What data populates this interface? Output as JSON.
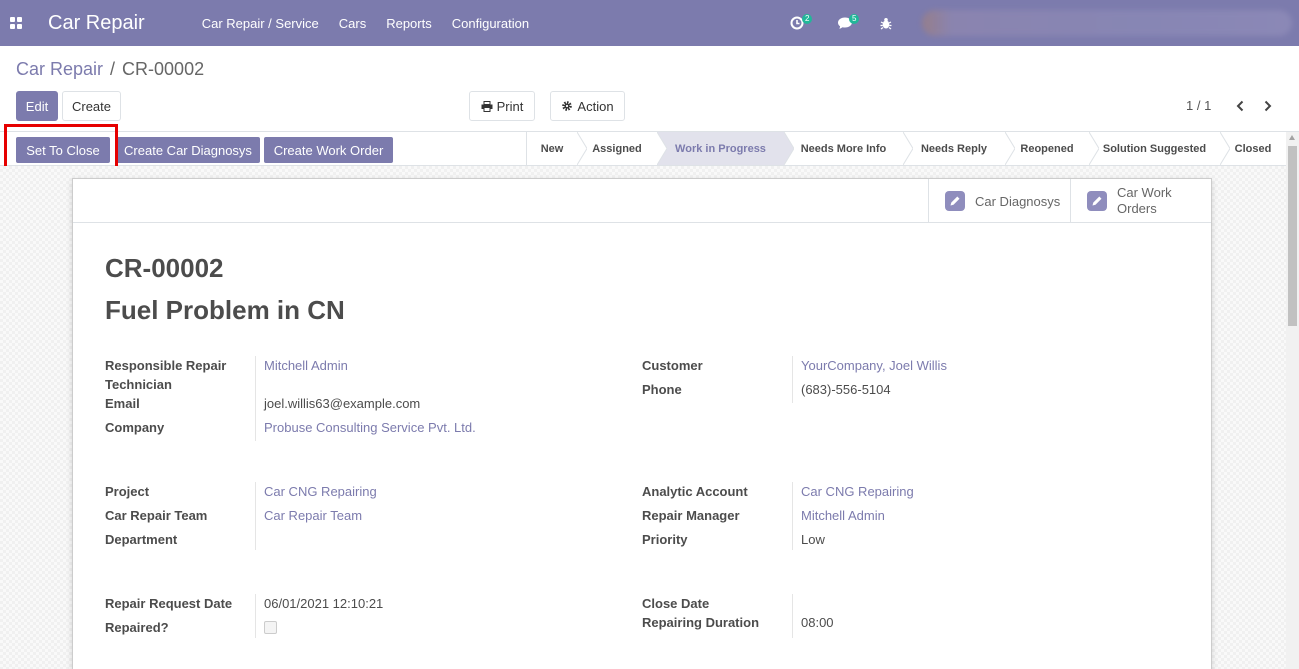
{
  "topbar": {
    "app_title": "Car Repair",
    "menu": [
      "Car Repair / Service",
      "Cars",
      "Reports",
      "Configuration"
    ],
    "activity_count": "2",
    "messages_count": "5"
  },
  "breadcrumb": {
    "parent": "Car Repair",
    "separator": "/",
    "current": "CR-00002"
  },
  "controls": {
    "edit": "Edit",
    "create": "Create",
    "print": "Print",
    "action": "Action",
    "pager": "1 / 1"
  },
  "header_buttons": {
    "set_to_close": "Set To Close",
    "create_diagnosys": "Create Car Diagnosys",
    "create_work_order": "Create Work Order"
  },
  "stages": [
    "New",
    "Assigned",
    "Work in Progress",
    "Needs More Info",
    "Needs Reply",
    "Reopened",
    "Solution Suggested",
    "Closed"
  ],
  "active_stage": "Work in Progress",
  "smart_buttons": {
    "diagnosys": "Car Diagnosys",
    "work_orders_line1": "Car Work",
    "work_orders_line2": "Orders"
  },
  "record": {
    "code": "CR-00002",
    "name": "Fuel Problem in CN"
  },
  "fields": {
    "technician_label": "Responsible Repair Technician",
    "technician": "Mitchell Admin",
    "email_label": "Email",
    "email": "joel.willis63@example.com",
    "company_label": "Company",
    "company": "Probuse Consulting Service Pvt. Ltd.",
    "customer_label": "Customer",
    "customer": "YourCompany, Joel Willis",
    "phone_label": "Phone",
    "phone": "(683)-556-5104",
    "project_label": "Project",
    "project": "Car CNG Repairing",
    "team_label": "Car Repair Team",
    "team": "Car Repair Team",
    "department_label": "Department",
    "department": "",
    "analytic_label": "Analytic Account",
    "analytic": "Car CNG Repairing",
    "manager_label": "Repair Manager",
    "manager": "Mitchell Admin",
    "priority_label": "Priority",
    "priority": "Low",
    "request_date_label": "Repair Request Date",
    "request_date": "06/01/2021 12:10:21",
    "repaired_label": "Repaired?",
    "repaired": false,
    "close_date_label": "Close Date",
    "close_date": "",
    "duration_label": "Repairing Duration",
    "duration": "08:00"
  },
  "colors": {
    "brand": "#7c7bad",
    "badge": "#21b799",
    "highlight": "#e60000"
  }
}
